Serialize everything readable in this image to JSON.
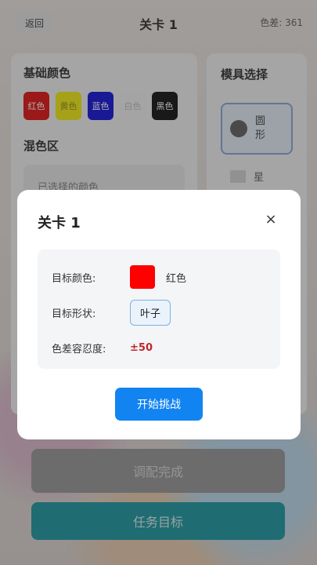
{
  "topbar": {
    "back_label": "返回",
    "title": "关卡 1",
    "diff_label": "色差: 361"
  },
  "palette": {
    "heading": "基础颜色",
    "colors": [
      {
        "label": "红色",
        "bg": "#e00000",
        "fg": "#ffffff"
      },
      {
        "label": "黄色",
        "bg": "#f2ea00",
        "fg": "#8a8a00"
      },
      {
        "label": "蓝色",
        "bg": "#0000d8",
        "fg": "#ffffff"
      },
      {
        "label": "白色",
        "bg": "#f0f0f0",
        "fg": "#bbbbbb"
      },
      {
        "label": "黑色",
        "bg": "#000000",
        "fg": "#ffffff"
      }
    ],
    "mix_heading": "混色区",
    "selected_placeholder": "已选择的颜色"
  },
  "mold": {
    "heading": "模具选择",
    "item1_label": "圆形",
    "item2_label": "星"
  },
  "buttons": {
    "mix_done": "调配完成",
    "task_goal": "任务目标"
  },
  "modal": {
    "title": "关卡 1",
    "close_symbol": "×",
    "target_color_label": "目标颜色:",
    "target_color_value": "红色",
    "target_color_hex": "#ff0000",
    "target_shape_label": "目标形状:",
    "target_shape_value": "叶子",
    "tolerance_label": "色差容忍度:",
    "tolerance_value": "±50",
    "start_label": "开始挑战"
  }
}
